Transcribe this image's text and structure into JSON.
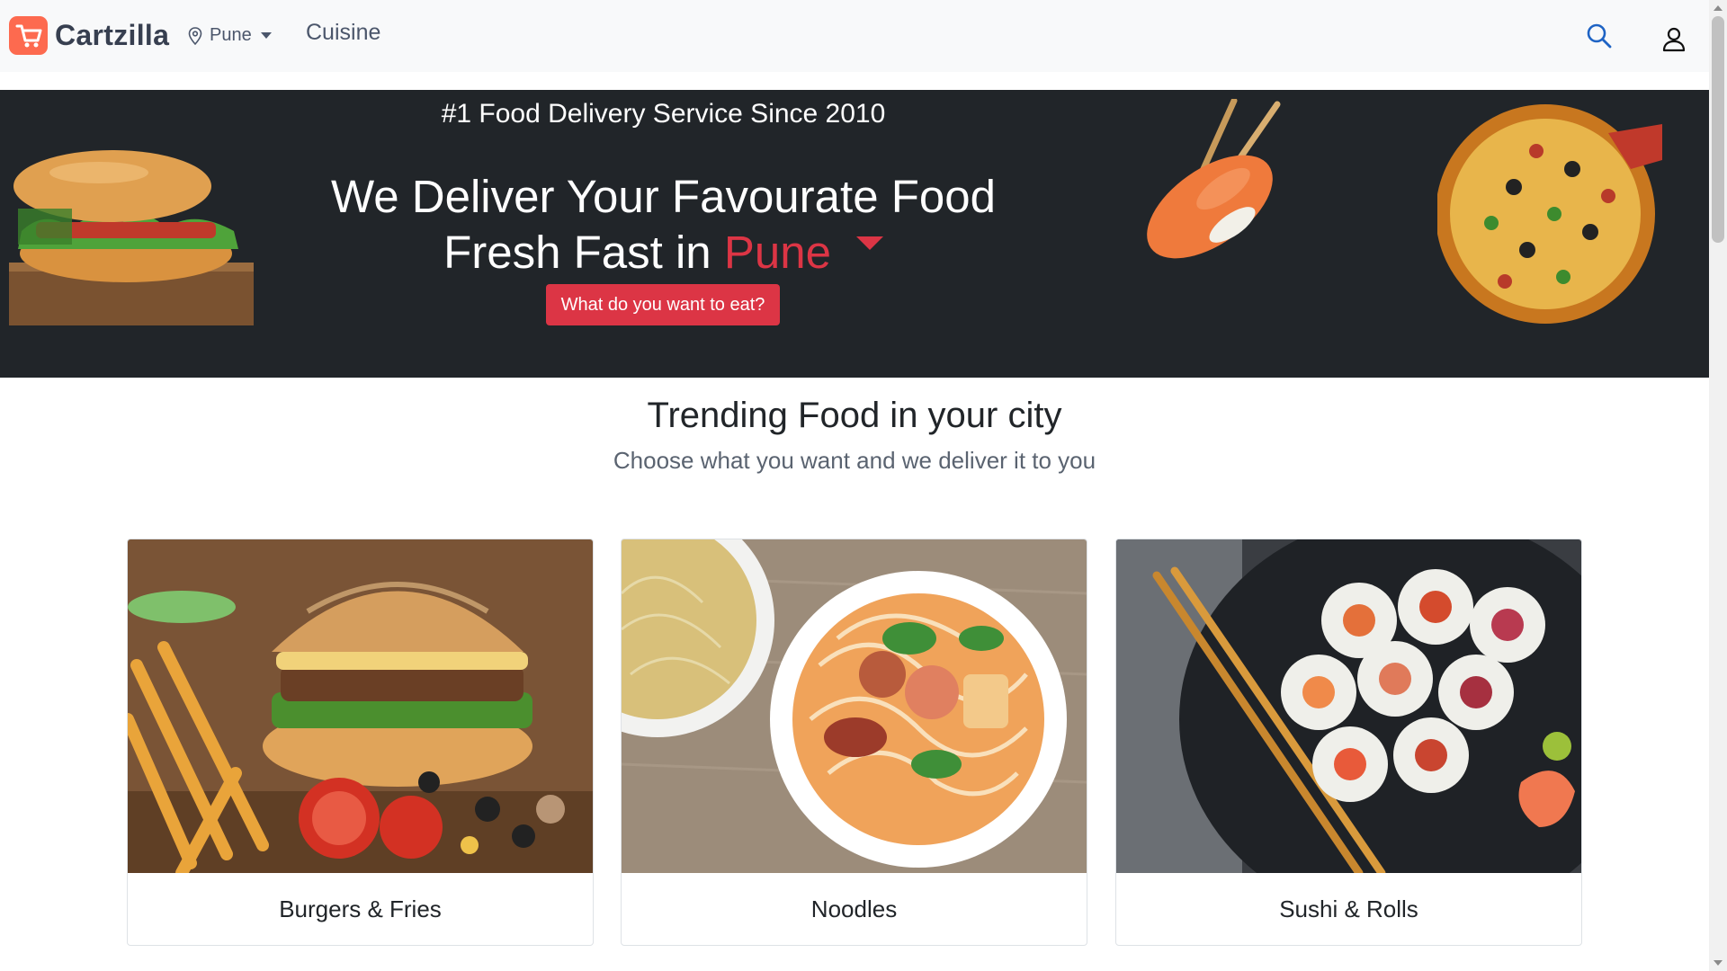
{
  "header": {
    "brand": "Cartzilla",
    "location": "Pune",
    "nav_cuisine": "Cuisine",
    "icons": [
      "cart-logo-icon",
      "map-pin-icon",
      "chevron-down-icon",
      "search-icon",
      "user-icon"
    ]
  },
  "hero": {
    "tagline": "#1 Food Delivery Service Since 2010",
    "title_line1": "We Deliver Your Favourate Food",
    "title_line2_prefix": "Fresh Fast in ",
    "city": "Pune",
    "cta": "What do you want to eat?",
    "accent_color": "#dc3545",
    "background_color": "#212529"
  },
  "trending": {
    "title": "Trending Food in your city",
    "subtitle": "Choose what you want and we deliver it to you",
    "items": [
      {
        "label": "Burgers & Fries"
      },
      {
        "label": "Noodles"
      },
      {
        "label": "Sushi & Rolls"
      }
    ]
  },
  "colors": {
    "brand_logo": "#fd6a4f",
    "navbar_bg": "#f8f9fa",
    "primary_red": "#dc3545"
  }
}
